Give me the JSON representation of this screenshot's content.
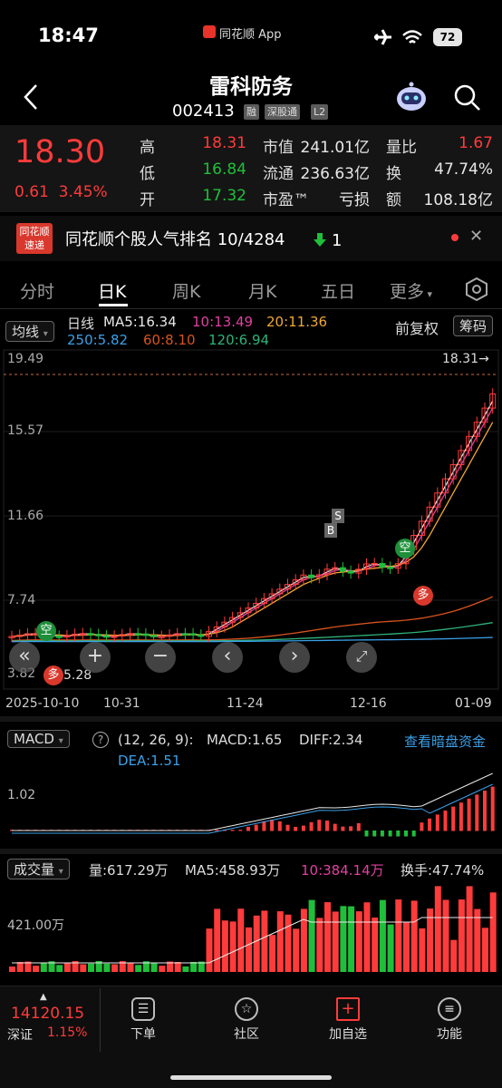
{
  "status_bar": {
    "time": "18:47",
    "brand": "同花顺 App",
    "battery": "72"
  },
  "header": {
    "name": "雷科防务",
    "code": "002413",
    "tags": [
      "融",
      "深股通",
      "L2"
    ]
  },
  "quote": {
    "price": "18.30",
    "change": "0.61",
    "change_pct": "3.45%",
    "rows": [
      {
        "l1": "高",
        "v1": "18.31",
        "c1": "red",
        "l2": "市值",
        "v2": "241.01亿",
        "l3": "量比",
        "v3": "1.67",
        "c3": "red"
      },
      {
        "l1": "低",
        "v1": "16.84",
        "c1": "green",
        "l2": "流通",
        "v2": "236.63亿",
        "l3": "换",
        "v3": "47.74%",
        "c3": "white"
      },
      {
        "l1": "开",
        "v1": "17.32",
        "c1": "green",
        "l2": "市盈™",
        "v2": "亏损",
        "l3": "额",
        "v3": "108.18亿",
        "c3": "white"
      }
    ]
  },
  "ranking": {
    "logo_top": "同花顺",
    "logo_bottom": "速递",
    "text": "同花顺个股人气排名 10/4284",
    "change": "1"
  },
  "tabs": [
    "分时",
    "日K",
    "周K",
    "月K",
    "五日",
    "更多"
  ],
  "kline": {
    "selector": "均线",
    "period": "日线",
    "ma": [
      {
        "text": "MA5:16.34",
        "color": "#e8e8e8"
      },
      {
        "text": "10:13.49",
        "color": "#e040a0"
      },
      {
        "text": "20:11.36",
        "color": "#f0a830"
      },
      {
        "text": "250:5.82",
        "color": "#3aa0e8"
      },
      {
        "text": "60:8.10",
        "color": "#d9531e"
      },
      {
        "text": "120:6.94",
        "color": "#2fb37a"
      }
    ],
    "fuquan": "前复权",
    "chouma": "筹码",
    "y_labels": [
      "19.49",
      "15.57",
      "11.66",
      "7.74",
      "3.82"
    ],
    "high_marker": "18.31→",
    "low_marker": "5.28",
    "dates": [
      "2025-10-10",
      "10-31",
      "11-24",
      "12-16",
      "01-09"
    ],
    "signals": {
      "kong": "空",
      "duo": "多",
      "buy": "B",
      "sell": "S"
    }
  },
  "macd": {
    "selector": "MACD",
    "params": "(12, 26, 9):",
    "macd": "MACD:1.65",
    "diff": "DIFF:2.34",
    "dea": "DEA:1.51",
    "link": "查看暗盘资金",
    "y_label": "1.02"
  },
  "volume": {
    "selector": "成交量",
    "vol": "量:617.29万",
    "ma5": "MA5:458.93万",
    "ma10": "10:384.14万",
    "turnover": "换手:47.74%",
    "y_label": "421.00万"
  },
  "bottom": {
    "index_value": "14120.15",
    "index_name": "深证",
    "index_pct": "1.15%",
    "nav": [
      "下单",
      "社区",
      "加自选",
      "功能"
    ]
  },
  "colors": {
    "up": "#ff3b3b",
    "down": "#1fbf3a",
    "bg": "#000000"
  }
}
